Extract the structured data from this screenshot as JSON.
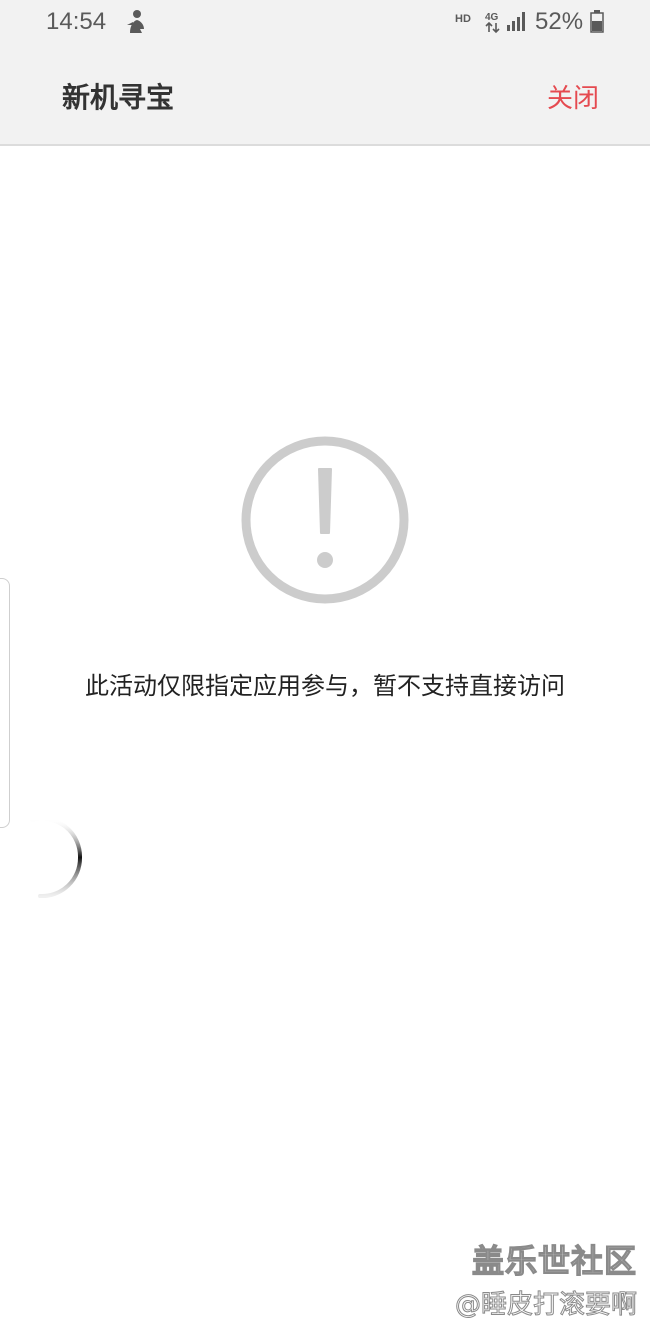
{
  "status_bar": {
    "time": "14:54",
    "network_type": "HD",
    "battery_percent": "52%",
    "icons": [
      "person-notification-icon",
      "4g-data-icon",
      "signal-strength-icon",
      "battery-icon"
    ]
  },
  "header": {
    "title": "新机寻宝",
    "close_label": "关闭"
  },
  "main": {
    "icon": "warning-circle-icon",
    "message": "此活动仅限指定应用参与，暂不支持直接访问"
  },
  "watermark": {
    "line1": "盖乐世社区",
    "line2": "@睡皮打滚要啊"
  },
  "colors": {
    "accent": "#e54a50",
    "header_background": "#f2f2f2",
    "icon_gray": "#cccccc"
  }
}
